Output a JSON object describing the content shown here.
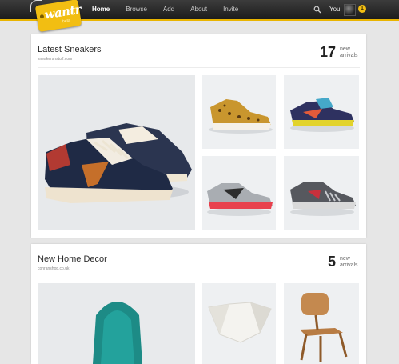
{
  "app": {
    "logo_text": "wantr",
    "logo_sub": "beta"
  },
  "nav": {
    "items": [
      "Home",
      "Browse",
      "Add",
      "About",
      "Invite"
    ],
    "active": "Home"
  },
  "user": {
    "label": "You",
    "notification_count": "1"
  },
  "colors": {
    "accent": "#f2be12",
    "topbar": "#2a2a2a",
    "page_bg": "#e6e6e6"
  },
  "sections": [
    {
      "title": "Latest Sneakers",
      "source": "sneakersnstuff.com",
      "count": "17",
      "count_label_line1": "new",
      "count_label_line2": "arrivals"
    },
    {
      "title": "New Home Decor",
      "source": "conranshop.co.uk",
      "count": "5",
      "count_label_line1": "new",
      "count_label_line2": "arrivals"
    }
  ]
}
